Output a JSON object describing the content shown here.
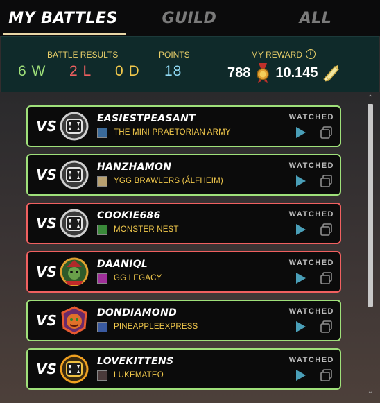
{
  "tabs": [
    {
      "label": "MY BATTLES",
      "active": true
    },
    {
      "label": "GUILD",
      "active": false
    },
    {
      "label": "ALL",
      "active": false
    }
  ],
  "summary": {
    "battle_results_label": "BATTLE RESULTS",
    "wins": "6 W",
    "losses": "2 L",
    "draws": "0 D",
    "points_label": "POINTS",
    "points": "18",
    "reward_label": "MY REWARD",
    "reward_amount": "788",
    "reward_amount_icon": "medal-icon",
    "reward_token": "10.145",
    "reward_token_icon": "scroll-icon"
  },
  "colors": {
    "win": "#9fe07a",
    "loss": "#f06060",
    "draw": "#f2c94c",
    "points": "#8fd8f2",
    "accent": "#e9cf6a"
  },
  "battles": [
    {
      "vs": "VS",
      "player": "EASIESTPEASANT",
      "guild": "THE MINI PRAETORIAN ARMY",
      "status": "WATCHED",
      "result": "win",
      "avatar": "silver-fangs-avatar"
    },
    {
      "vs": "VS",
      "player": "HANZHAMON",
      "guild": "YGG BRAWLERS (ÁLFHEIM)",
      "status": "WATCHED",
      "result": "win",
      "avatar": "silver-fangs-avatar"
    },
    {
      "vs": "VS",
      "player": "COOKIE686",
      "guild": "MONSTER NEST",
      "status": "WATCHED",
      "result": "loss",
      "avatar": "silver-fangs-avatar"
    },
    {
      "vs": "VS",
      "player": "DAANIQL",
      "guild": "GG LEGACY",
      "status": "WATCHED",
      "result": "loss",
      "avatar": "goblin-avatar"
    },
    {
      "vs": "VS",
      "player": "DONDIAMOND",
      "guild": "PINEAPPLEEXPRESS",
      "status": "WATCHED",
      "result": "win",
      "avatar": "orange-creature-avatar"
    },
    {
      "vs": "VS",
      "player": "LOVEKITTENS",
      "guild": "LUKEMATEO",
      "status": "WATCHED",
      "result": "win",
      "avatar": "gold-fangs-avatar"
    }
  ]
}
